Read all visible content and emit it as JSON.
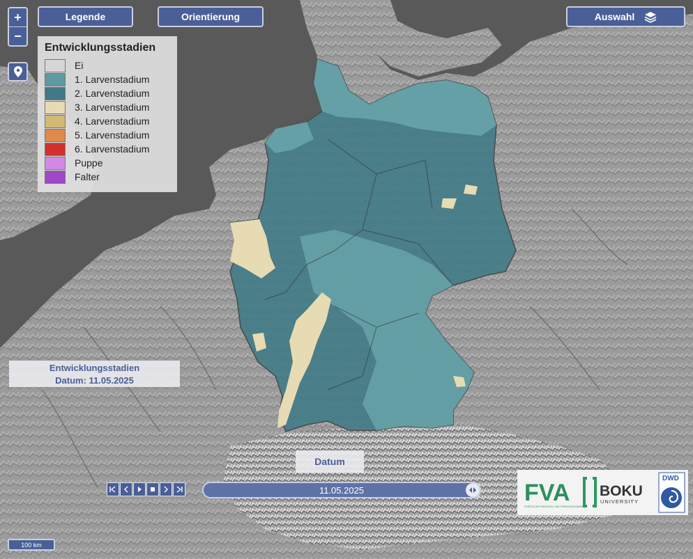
{
  "toolbar": {
    "zoom_in": "+",
    "zoom_out": "−",
    "legend_button": "Legende",
    "orientation_button": "Orientierung",
    "selection_button": "Auswahl"
  },
  "legend": {
    "title": "Entwicklungsstadien",
    "items": [
      {
        "label": "Ei",
        "color": "#d6d6d6"
      },
      {
        "label": "1. Larvenstadium",
        "color": "#5e9aa1"
      },
      {
        "label": "2. Larvenstadium",
        "color": "#3f7a86"
      },
      {
        "label": "3. Larvenstadium",
        "color": "#e6dbb2"
      },
      {
        "label": "4. Larvenstadium",
        "color": "#d4b876"
      },
      {
        "label": "5. Larvenstadium",
        "color": "#e08a49"
      },
      {
        "label": "6. Larvenstadium",
        "color": "#d2322e"
      },
      {
        "label": "Puppe",
        "color": "#d08ae6"
      },
      {
        "label": "Falter",
        "color": "#a047c8"
      }
    ]
  },
  "info": {
    "title": "Entwicklungsstadien",
    "date_line": "Datum: 11.05.2025"
  },
  "timeline": {
    "label": "Datum",
    "value": "11.05.2025"
  },
  "logos": {
    "fva": "FVA",
    "fva_sub": "FORSTLICHE VERSUCHS- UND FORSCHUNGSANSTALT",
    "boku": "BOKU",
    "boku_sub": "UNIVERSITY",
    "dwd": "DWD"
  },
  "scale_bar": "100 km",
  "colors": {
    "accent": "#4a5f98",
    "land": "#9a9a9a",
    "water": "#5a5a5a"
  }
}
